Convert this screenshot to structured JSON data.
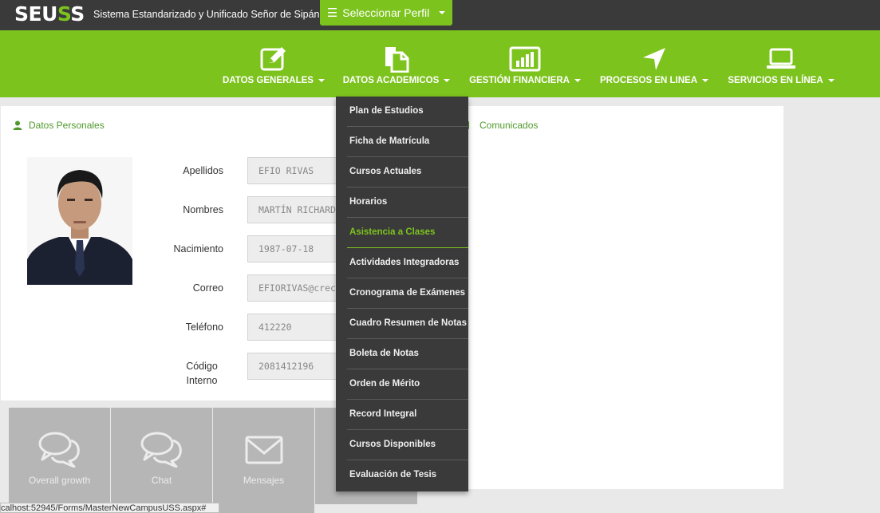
{
  "header": {
    "brand_prefix": "SEU",
    "brand_accent": "S",
    "brand_suffix": "S",
    "subtitle": "Sistema Estandarizado y Unificado Señor de Sipán",
    "profile_button": "Seleccionar Perfil"
  },
  "nav": {
    "items": [
      {
        "label": "DATOS GENERALES",
        "icon": "edit-icon"
      },
      {
        "label": "DATOS ACADEMICOS",
        "icon": "documents-icon"
      },
      {
        "label": "GESTIÓN FINANCIERA",
        "icon": "bar-chart-icon"
      },
      {
        "label": "PROCESOS EN LINEA",
        "icon": "location-arrow-icon"
      },
      {
        "label": "SERVICIOS EN LÍNEA",
        "icon": "laptop-icon"
      }
    ]
  },
  "personal": {
    "title": "Datos Personales",
    "fields": [
      {
        "label": "Apellidos",
        "value": "EFIO RIVAS"
      },
      {
        "label": "Nombres",
        "value": "MARTÍN RICHARD"
      },
      {
        "label": "Nacimiento",
        "value": "1987-07-18"
      },
      {
        "label": "Correo",
        "value": "EFIORIVAS@crece"
      },
      {
        "label": "Teléfono",
        "value": "412220"
      },
      {
        "label": "Código Interno",
        "value": "2081412196"
      }
    ]
  },
  "announcements": {
    "title": "Comunicados"
  },
  "tiles": [
    {
      "label": "Overall growth",
      "icon": "chat-bubbles-icon"
    },
    {
      "label": "Chat",
      "icon": "chat-bubbles-icon"
    },
    {
      "label": "Mensajes",
      "icon": "envelope-icon"
    }
  ],
  "dropdown": {
    "items": [
      "Plan de Estudios",
      "Ficha de Matrícula",
      "Cursos Actuales",
      "Horarios",
      "Asistencia a Clases",
      "Actividades Integradoras",
      "Cronograma de Exámenes",
      "Cuadro Resumen de Notas",
      "Boleta de Notas",
      "Orden de Mérito",
      "Record Integral",
      "Cursos Disponibles",
      "Evaluación de Tesis"
    ],
    "active_index": 4
  },
  "status_bar": {
    "url": "calhost:52945/Forms/MasterNewCampusUSS.aspx#"
  },
  "colors": {
    "brand_green": "#7dc31e",
    "dark_bar": "#3a3a3a",
    "tile_gray": "#b6b6b6"
  }
}
